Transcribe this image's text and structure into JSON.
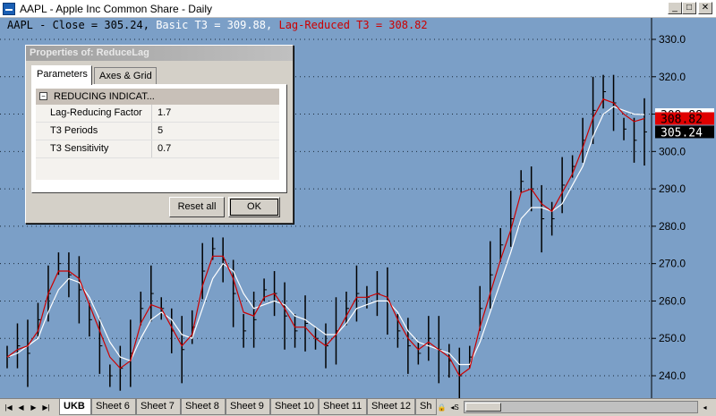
{
  "window": {
    "title": "AAPL - Apple Inc Common Share - Daily",
    "minimize_label": "_",
    "maximize_label": "□",
    "close_label": "✕"
  },
  "legend": {
    "prefix": "AAPL - Close = 305.24,",
    "basic": "Basic T3 = 309.88,",
    "reduced": "Lag-Reduced T3 = 308.82"
  },
  "colors": {
    "chart_bg": "#7b9fc7",
    "bars": "#000000",
    "basic_t3": "#ffffff",
    "reduced_t3": "#cc0000"
  },
  "chart_data": {
    "type": "line",
    "title": "AAPL - Apple Inc Common Share - Daily",
    "ylim": [
      235,
      335
    ],
    "y_ticks": [
      "330.0",
      "320.0",
      "310.0",
      "300.0",
      "290.0",
      "280.0",
      "270.0",
      "260.0",
      "250.0",
      "240.0"
    ],
    "grid": true,
    "series": [
      {
        "name": "AAPL - Close",
        "values": [
          245,
          248,
          246,
          255,
          262,
          270,
          267,
          263,
          255,
          248,
          240,
          242,
          246,
          258,
          262,
          258,
          252,
          247,
          253,
          268,
          274,
          271,
          262,
          252,
          255,
          263,
          262,
          256,
          252,
          254,
          250,
          248,
          252,
          258,
          262,
          261,
          262,
          260,
          252,
          248,
          246,
          250,
          247,
          244,
          240,
          245,
          258,
          267,
          275,
          282,
          292,
          290,
          282,
          282,
          291,
          296,
          303,
          311,
          316,
          313,
          306,
          303,
          305.24
        ]
      },
      {
        "name": "Basic T3",
        "values": [
          245,
          246,
          248,
          250,
          257,
          263,
          266,
          265,
          261,
          255,
          249,
          245,
          244,
          250,
          255,
          257,
          255,
          251,
          250,
          258,
          266,
          270,
          268,
          262,
          258,
          259,
          260,
          259,
          256,
          255,
          253,
          251,
          251,
          254,
          258,
          259,
          260,
          260,
          257,
          252,
          249,
          248,
          247,
          246,
          243,
          243,
          249,
          257,
          265,
          273,
          282,
          285,
          285,
          284,
          286,
          291,
          296,
          304,
          310,
          312,
          311,
          310,
          309.88
        ]
      },
      {
        "name": "Lag-Reduced T3",
        "values": [
          245,
          247,
          248,
          252,
          262,
          268,
          268,
          266,
          259,
          252,
          245,
          242,
          244,
          254,
          259,
          258,
          253,
          248,
          251,
          264,
          272,
          272,
          266,
          257,
          256,
          261,
          262,
          258,
          253,
          253,
          250,
          248,
          251,
          256,
          261,
          261,
          262,
          261,
          255,
          250,
          247,
          249,
          247,
          245,
          240,
          242,
          253,
          262,
          271,
          279,
          289,
          290,
          286,
          284,
          289,
          294,
          301,
          309,
          314,
          313,
          310,
          308,
          308.82
        ]
      }
    ],
    "price_labels": [
      {
        "text": "309.88",
        "kind": "basic"
      },
      {
        "text": "308.82",
        "kind": "reduced"
      },
      {
        "text": "305.24",
        "kind": "close"
      }
    ]
  },
  "dialog": {
    "title": "Properties of: ReduceLag",
    "tabs": [
      "Parameters",
      "Axes & Grid"
    ],
    "category": "REDUCING INDICAT...",
    "category_toggle": "−",
    "rows": [
      {
        "name": "Lag-Reducing Factor",
        "value": "1.7"
      },
      {
        "name": "T3 Periods",
        "value": "5"
      },
      {
        "name": "T3 Sensitivity",
        "value": "0.7"
      }
    ],
    "reset_label": "Reset all",
    "ok_label": "OK"
  },
  "sheets": {
    "nav": [
      "|◀",
      "◀",
      "▶",
      "▶|"
    ],
    "tabs": [
      "UKB",
      "Sheet 6",
      "Sheet 7",
      "Sheet 8",
      "Sheet 9",
      "Sheet 10",
      "Sheet 11",
      "Sheet 12",
      "Sh"
    ],
    "lock_label": "🔒",
    "scroll_label": "◂S",
    "scroll_right": "◂"
  }
}
